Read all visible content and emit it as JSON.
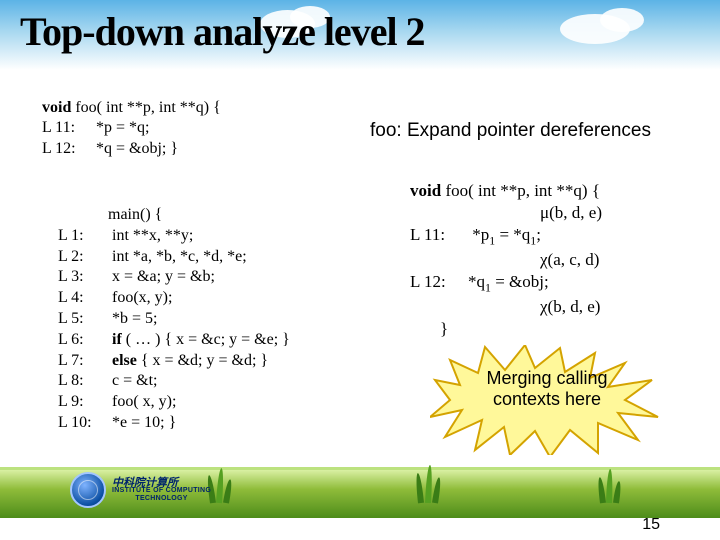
{
  "title": "Top-down analyze level 2",
  "foo_block": {
    "sig_kw": "void",
    "sig_rest": " foo( int **p, int **q) {",
    "l11_label": "L 11:",
    "l11_code": "*p = *q;",
    "l12_label": "L 12:",
    "l12_code": "*q = &obj;   }"
  },
  "main_block": {
    "head": "main() {",
    "lines": [
      {
        "label": "L 1:",
        "code": "int  **x, **y;"
      },
      {
        "label": "L 2:",
        "code": "int  *a, *b, *c, *d, *e;"
      },
      {
        "label": "L 3:",
        "code": "x = &a;   y = &b;"
      },
      {
        "label": "L 4:",
        "code": "foo(x, y);"
      },
      {
        "label": "L 5:",
        "code": "*b = 5;"
      },
      {
        "label": "L 6:",
        "kw": "if",
        "code": " ( … )   {  x = &c; y = &e; }"
      },
      {
        "label": "L 7:",
        "kw": "else",
        "code": "   { x = &d;   y = &d; }"
      },
      {
        "label": "L 8:",
        "code": "c = &t;"
      },
      {
        "label": "L 9:",
        "code": "foo( x, y);"
      },
      {
        "label": "L 10:",
        "code": "*e = 10;  }"
      }
    ]
  },
  "right_note": "foo:  Expand pointer dereferences",
  "right_block": {
    "sig_kw": "void",
    "sig_rest": " foo( int **p, int **q)  {",
    "mu": "μ(b, d, e)",
    "l11_label": "L 11:",
    "l11_code_a": "*p",
    "l11_code_b": " = *q",
    "l11_code_c": ";",
    "chi1": "χ(a, c, d)",
    "l12_label": "L 12:",
    "l12_code_a": "*q",
    "l12_code_b": " = &obj;",
    "chi2": "χ(b, d, e)",
    "close": "}"
  },
  "starburst": {
    "line1": "Merging calling",
    "line2": "contexts here"
  },
  "footer": {
    "chinese": "中科院计算所",
    "inst_line1": "INSTITUTE OF COMPUTING",
    "inst_line2": "TECHNOLOGY"
  },
  "page_number": "15"
}
